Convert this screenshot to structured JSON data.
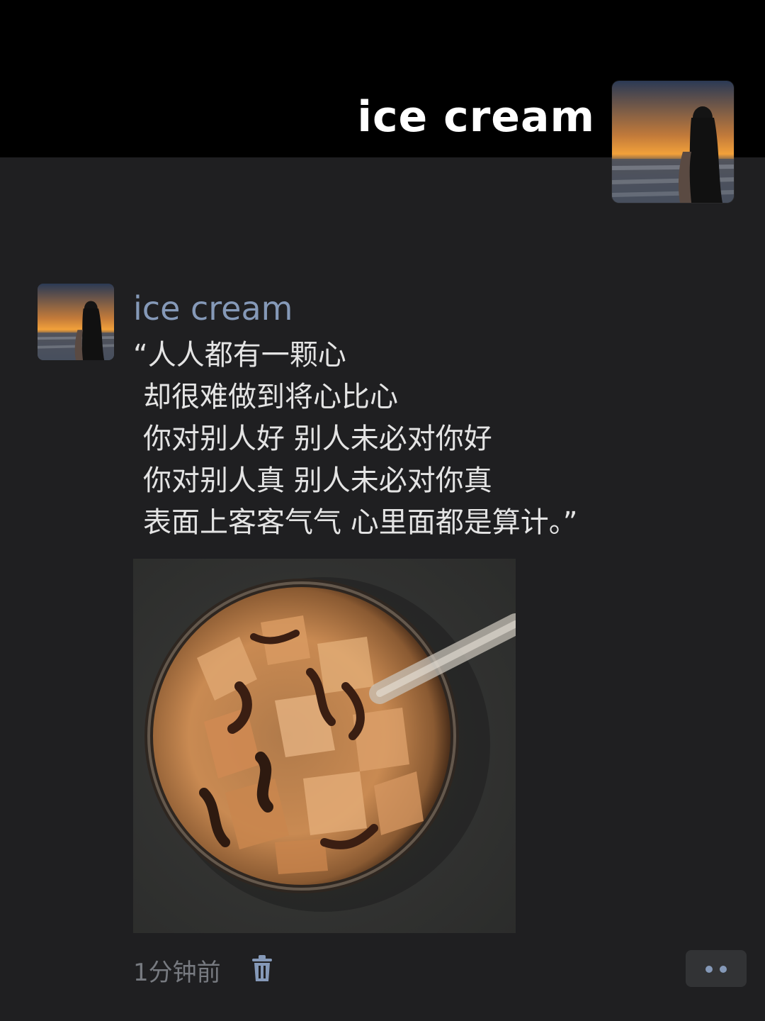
{
  "header": {
    "username": "ice cream",
    "avatar_icon": "sunset-girl-avatar"
  },
  "post": {
    "author": "ice cream",
    "avatar_icon": "sunset-girl-avatar",
    "lines": [
      "“人人都有一颗心",
      "却很难做到将心比心",
      "你对别人好 别人未必对你好",
      "你对别人真 别人未必对你真",
      "表面上客客气气 心里面都是算计。”"
    ],
    "image_icon": "iced-latte-photo",
    "timestamp": "1分钟前"
  },
  "colors": {
    "background": "#1f1f21",
    "cover": "#000000",
    "author_name": "#8599b8",
    "text": "#e4e4e4",
    "muted": "#777a80"
  }
}
